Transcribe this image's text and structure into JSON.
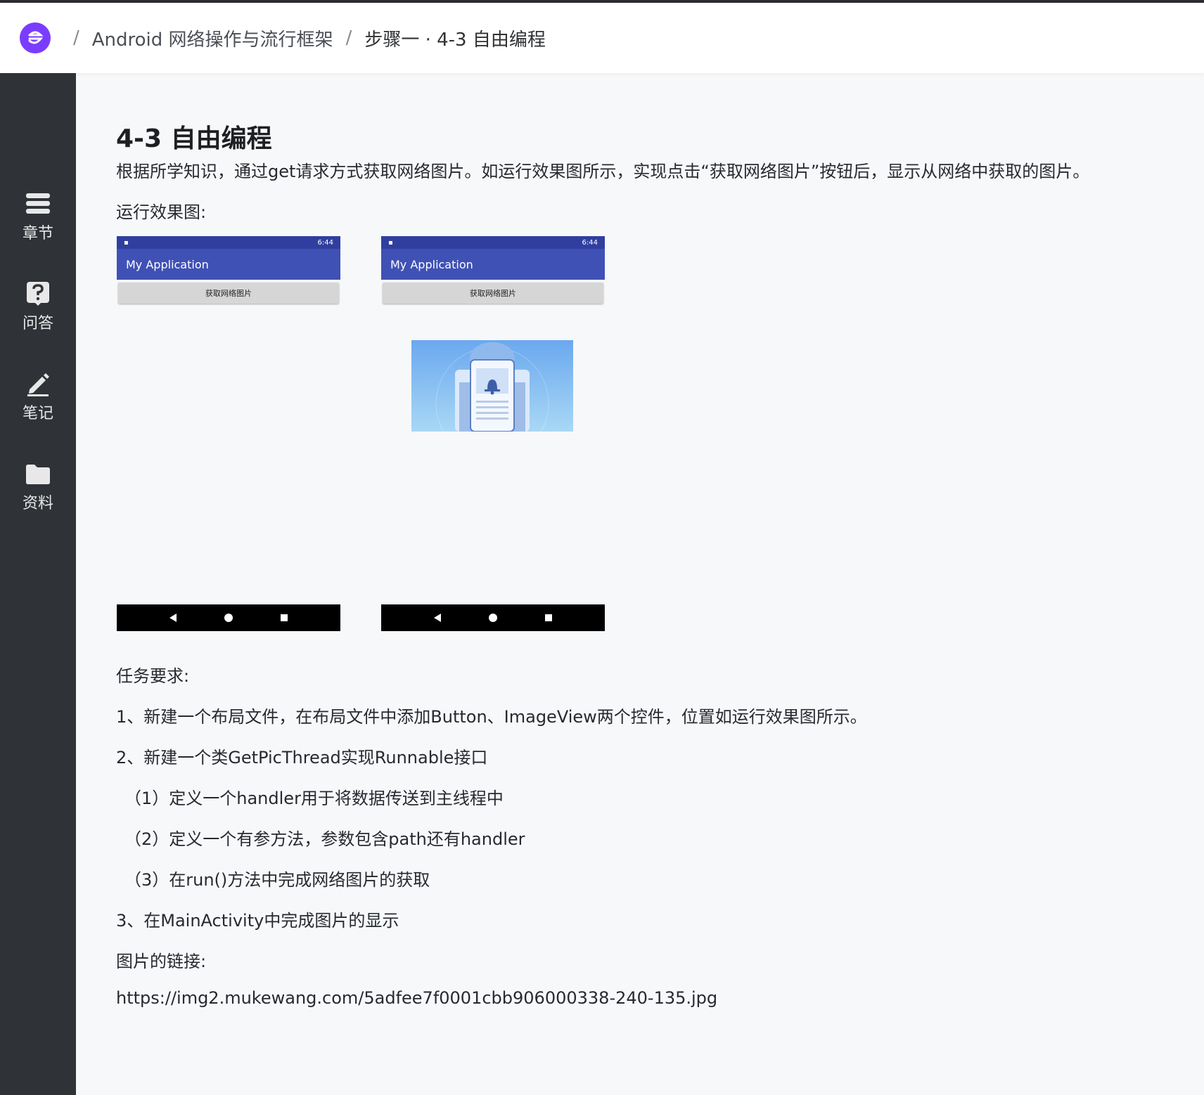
{
  "header": {
    "logo_icon": "imooc-logo-icon",
    "breadcrumb": {
      "separator": "/",
      "course": "Android 网络操作与流行框架",
      "step": "步骤一 · 4-3 自由编程"
    }
  },
  "sidebar": {
    "items": [
      {
        "label": "章节",
        "icon": "list-icon"
      },
      {
        "label": "问答",
        "icon": "question-icon"
      },
      {
        "label": "笔记",
        "icon": "pen-icon"
      },
      {
        "label": "资料",
        "icon": "folder-icon"
      }
    ]
  },
  "main": {
    "title": "4-3 自由编程",
    "intro": "根据所学知识，通过get请求方式获取网络图片。如运行效果图所示，实现点击“获取网络图片”按钮后，显示从网络中获取的图片。",
    "preview_label": "运行效果图:",
    "phones": [
      {
        "time": "6:44",
        "app_title": "My Application",
        "button": "获取网络图片",
        "has_image": false
      },
      {
        "time": "6:44",
        "app_title": "My Application",
        "button": "获取网络图片",
        "has_image": true
      }
    ],
    "task_label": "任务要求:",
    "tasks": [
      "1、新建一个布局文件，在布局文件中添加Button、ImageView两个控件，位置如运行效果图所示。",
      "2、新建一个类GetPicThread实现Runnable接口",
      "（1）定义一个handler用于将数据传送到主线程中",
      "（2）定义一个有参方法，参数包含path还有handler",
      "（3）在run()方法中完成网络图片的获取",
      "3、在MainActivity中完成图片的显示"
    ],
    "link_label": "图片的链接:",
    "link": "https://img2.mukewang.com/5adfee7f0001cbb906000338-240-135.jpg"
  },
  "colors": {
    "sidebar_bg": "#2f3237",
    "logo": "#7a3cff",
    "app_bar": "#3f51b5",
    "status_bar": "#303f9f"
  }
}
